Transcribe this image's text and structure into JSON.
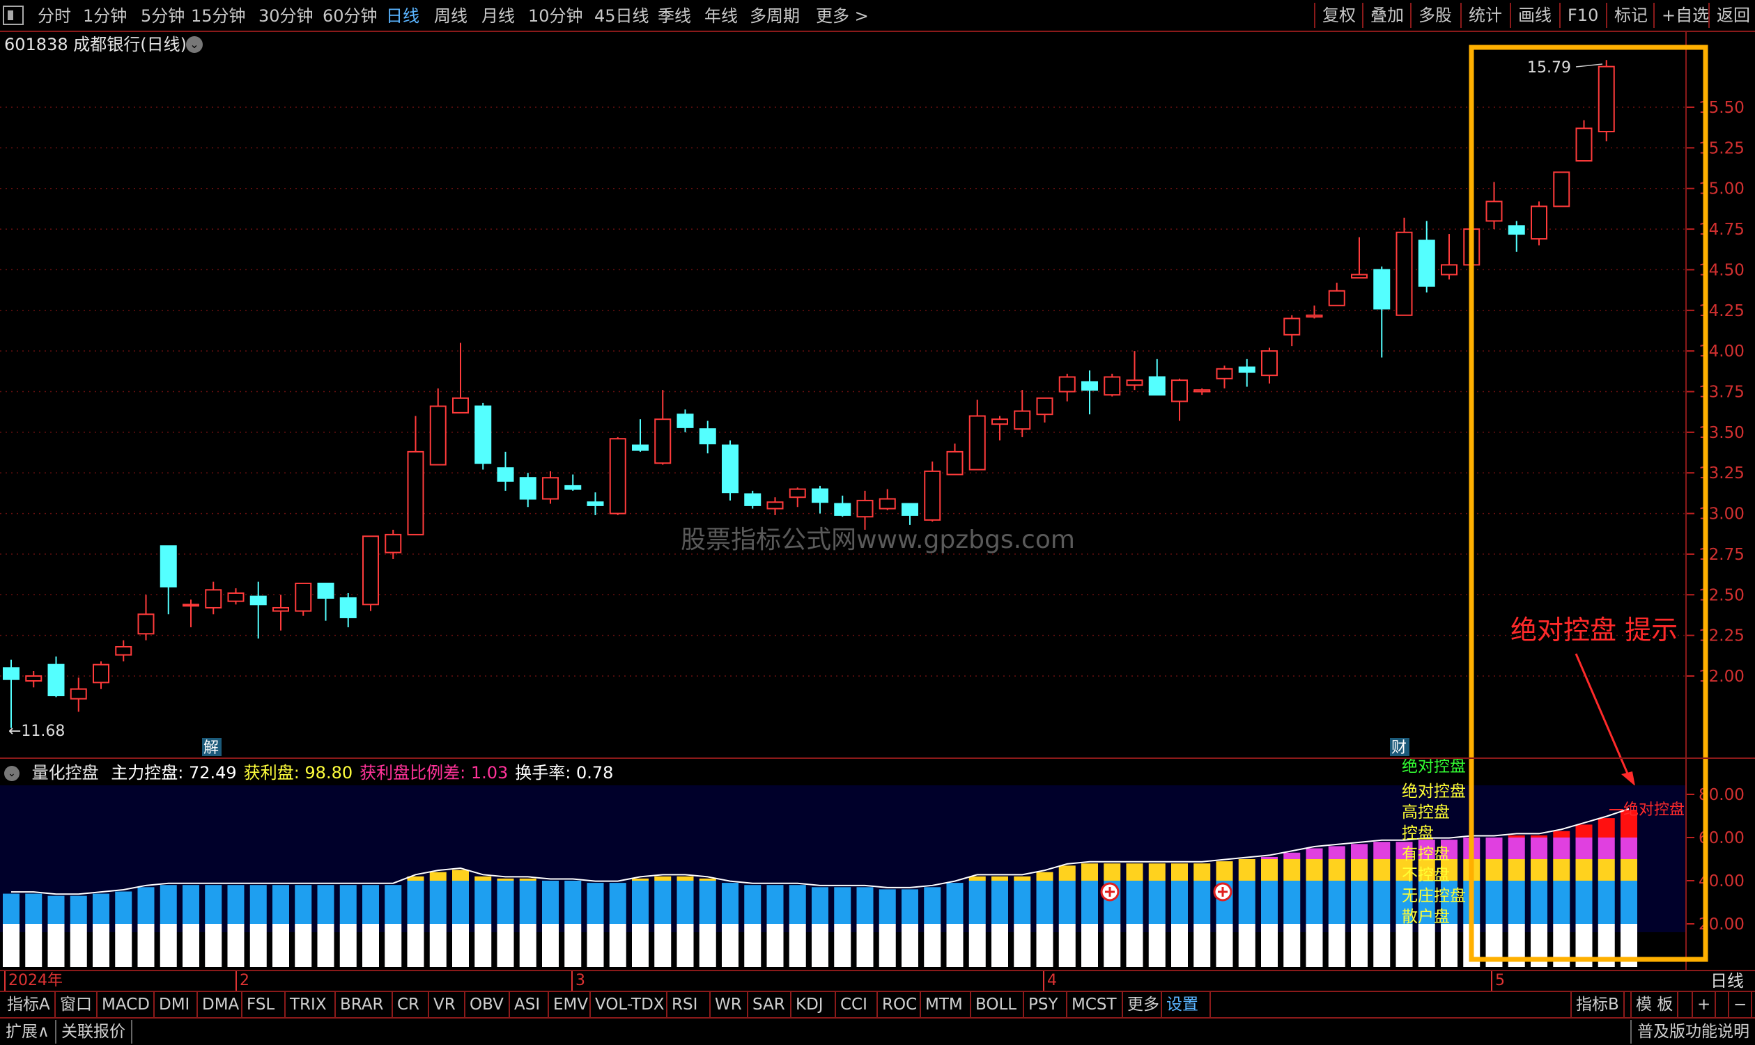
{
  "toolbar": {
    "periods": [
      "分时",
      "1分钟",
      "5分钟",
      "15分钟",
      "30分钟",
      "60分钟",
      "日线",
      "周线",
      "月线",
      "10分钟",
      "45日线",
      "季线",
      "年线",
      "多周期",
      "更多 >"
    ],
    "active_period": "日线",
    "right_buttons": [
      "复权",
      "叠加",
      "多股",
      "统计",
      "画线",
      "F10",
      "标记",
      "+自选",
      "返回"
    ]
  },
  "stock": {
    "title": "601838 成都银行(日线)"
  },
  "price_axis": [
    "15.50",
    "15.25",
    "15.00",
    "14.75",
    "14.50",
    "14.25",
    "14.00",
    "13.75",
    "13.50",
    "13.25",
    "13.00",
    "12.75",
    "12.50",
    "12.25",
    "12.00"
  ],
  "annotations": {
    "high_label": "15.79",
    "low_label": "←11.68",
    "watermark": "股票指标公式网www.gpzbgs.com",
    "hint": "绝对控盘 提示",
    "marker_jie": "解",
    "marker_cai": "财",
    "end_label": "绝对控盘"
  },
  "indicator": {
    "name": "量化控盘",
    "fields": [
      {
        "label": "主力控盘:",
        "value": "72.49",
        "color": "#ffffff"
      },
      {
        "label": "获利盘:",
        "value": "98.80",
        "color": "#ffff3c"
      },
      {
        "label": "获利盘比例差:",
        "value": "1.03",
        "color": "#ff3399"
      },
      {
        "label": "换手率:",
        "value": "0.78",
        "color": "#ffffff"
      }
    ],
    "axis": [
      "80.00",
      "60.00",
      "40.00",
      "20.00"
    ],
    "legend": [
      {
        "text": "绝对控盘",
        "color": "#33ff33"
      },
      {
        "text": "绝对控盘",
        "color": "#ffff33"
      },
      {
        "text": "高控盘",
        "color": "#ffff33"
      },
      {
        "text": "控盘",
        "color": "#ffff33"
      },
      {
        "text": "有控盘",
        "color": "#ffff33"
      },
      {
        "text": "不控盘",
        "color": "#ffff33"
      },
      {
        "text": "无庄控盘",
        "color": "#ffff33"
      },
      {
        "text": "散户盘",
        "color": "#ffff33"
      }
    ]
  },
  "date_axis": {
    "labels": [
      "2024年",
      "2",
      "3",
      "4",
      "5"
    ],
    "period": "日线"
  },
  "bottom_tabs": [
    "指标A",
    "窗口",
    "MACD",
    "DMI",
    "DMA",
    "FSL",
    "TRIX",
    "BRAR",
    "CR",
    "VR",
    "OBV",
    "ASI",
    "EMV",
    "VOL-TDX",
    "RSI",
    "WR",
    "SAR",
    "KDJ",
    "CCI",
    "ROC",
    "MTM",
    "BOLL",
    "PSY",
    "MCST",
    "更多",
    "设置"
  ],
  "bottom_right": [
    "指标B",
    "模 板",
    "+",
    "−"
  ],
  "status": {
    "left": [
      "扩展∧",
      "关联报价"
    ],
    "right": "普及版功能说明"
  },
  "chart_data": {
    "type": "candlestick",
    "price_range": [
      11.68,
      15.79
    ],
    "candles": [
      {
        "o": 12.05,
        "h": 12.1,
        "l": 11.68,
        "c": 11.98
      },
      {
        "o": 11.97,
        "h": 12.03,
        "l": 11.93,
        "c": 12.0
      },
      {
        "o": 12.07,
        "h": 12.12,
        "l": 11.87,
        "c": 11.88
      },
      {
        "o": 11.86,
        "h": 11.99,
        "l": 11.78,
        "c": 11.92
      },
      {
        "o": 11.96,
        "h": 12.09,
        "l": 11.92,
        "c": 12.07
      },
      {
        "o": 12.13,
        "h": 12.22,
        "l": 12.09,
        "c": 12.18
      },
      {
        "o": 12.26,
        "h": 12.5,
        "l": 12.22,
        "c": 12.38
      },
      {
        "o": 12.8,
        "h": 12.8,
        "l": 12.38,
        "c": 12.55
      },
      {
        "o": 12.44,
        "h": 12.47,
        "l": 12.3,
        "c": 12.44
      },
      {
        "o": 12.42,
        "h": 12.58,
        "l": 12.38,
        "c": 12.53
      },
      {
        "o": 12.46,
        "h": 12.54,
        "l": 12.44,
        "c": 12.51
      },
      {
        "o": 12.49,
        "h": 12.58,
        "l": 12.23,
        "c": 12.44
      },
      {
        "o": 12.4,
        "h": 12.5,
        "l": 12.28,
        "c": 12.42
      },
      {
        "o": 12.4,
        "h": 12.57,
        "l": 12.37,
        "c": 12.57
      },
      {
        "o": 12.57,
        "h": 12.57,
        "l": 12.34,
        "c": 12.48
      },
      {
        "o": 12.48,
        "h": 12.51,
        "l": 12.3,
        "c": 12.36
      },
      {
        "o": 12.44,
        "h": 12.86,
        "l": 12.4,
        "c": 12.86
      },
      {
        "o": 12.76,
        "h": 12.9,
        "l": 12.72,
        "c": 12.87
      },
      {
        "o": 12.87,
        "h": 13.6,
        "l": 12.87,
        "c": 13.38
      },
      {
        "o": 13.3,
        "h": 13.77,
        "l": 13.3,
        "c": 13.66
      },
      {
        "o": 13.62,
        "h": 14.05,
        "l": 13.62,
        "c": 13.71
      },
      {
        "o": 13.66,
        "h": 13.68,
        "l": 13.27,
        "c": 13.31
      },
      {
        "o": 13.28,
        "h": 13.38,
        "l": 13.14,
        "c": 13.2
      },
      {
        "o": 13.22,
        "h": 13.25,
        "l": 13.04,
        "c": 13.09
      },
      {
        "o": 13.09,
        "h": 13.26,
        "l": 13.06,
        "c": 13.22
      },
      {
        "o": 13.17,
        "h": 13.24,
        "l": 13.14,
        "c": 13.15
      },
      {
        "o": 13.07,
        "h": 13.13,
        "l": 12.99,
        "c": 13.05
      },
      {
        "o": 13.0,
        "h": 13.47,
        "l": 12.99,
        "c": 13.46
      },
      {
        "o": 13.42,
        "h": 13.58,
        "l": 13.38,
        "c": 13.39
      },
      {
        "o": 13.31,
        "h": 13.76,
        "l": 13.3,
        "c": 13.58
      },
      {
        "o": 13.61,
        "h": 13.64,
        "l": 13.5,
        "c": 13.53
      },
      {
        "o": 13.52,
        "h": 13.57,
        "l": 13.37,
        "c": 13.43
      },
      {
        "o": 13.42,
        "h": 13.45,
        "l": 13.08,
        "c": 13.13
      },
      {
        "o": 13.12,
        "h": 13.14,
        "l": 13.03,
        "c": 13.05
      },
      {
        "o": 13.03,
        "h": 13.1,
        "l": 12.99,
        "c": 13.07
      },
      {
        "o": 13.1,
        "h": 13.16,
        "l": 13.04,
        "c": 13.15
      },
      {
        "o": 13.15,
        "h": 13.17,
        "l": 13.0,
        "c": 13.07
      },
      {
        "o": 13.06,
        "h": 13.11,
        "l": 12.98,
        "c": 12.99
      },
      {
        "o": 12.98,
        "h": 13.14,
        "l": 12.9,
        "c": 13.08
      },
      {
        "o": 13.03,
        "h": 13.15,
        "l": 13.02,
        "c": 13.09
      },
      {
        "o": 13.06,
        "h": 13.06,
        "l": 12.93,
        "c": 12.99
      },
      {
        "o": 12.96,
        "h": 13.32,
        "l": 12.95,
        "c": 13.26
      },
      {
        "o": 13.24,
        "h": 13.43,
        "l": 13.24,
        "c": 13.38
      },
      {
        "o": 13.27,
        "h": 13.7,
        "l": 13.27,
        "c": 13.6
      },
      {
        "o": 13.55,
        "h": 13.6,
        "l": 13.45,
        "c": 13.58
      },
      {
        "o": 13.52,
        "h": 13.76,
        "l": 13.47,
        "c": 13.63
      },
      {
        "o": 13.61,
        "h": 13.71,
        "l": 13.56,
        "c": 13.71
      },
      {
        "o": 13.75,
        "h": 13.86,
        "l": 13.69,
        "c": 13.84
      },
      {
        "o": 13.81,
        "h": 13.88,
        "l": 13.61,
        "c": 13.76
      },
      {
        "o": 13.73,
        "h": 13.86,
        "l": 13.72,
        "c": 13.84
      },
      {
        "o": 13.79,
        "h": 14.0,
        "l": 13.76,
        "c": 13.82
      },
      {
        "o": 13.84,
        "h": 13.95,
        "l": 13.75,
        "c": 13.73
      },
      {
        "o": 13.69,
        "h": 13.83,
        "l": 13.57,
        "c": 13.82
      },
      {
        "o": 13.75,
        "h": 13.77,
        "l": 13.73,
        "c": 13.76
      },
      {
        "o": 13.83,
        "h": 13.91,
        "l": 13.77,
        "c": 13.89
      },
      {
        "o": 13.9,
        "h": 13.95,
        "l": 13.78,
        "c": 13.87
      },
      {
        "o": 13.85,
        "h": 14.02,
        "l": 13.8,
        "c": 14.0
      },
      {
        "o": 14.1,
        "h": 14.22,
        "l": 14.03,
        "c": 14.2
      },
      {
        "o": 14.21,
        "h": 14.28,
        "l": 14.2,
        "c": 14.22
      },
      {
        "o": 14.28,
        "h": 14.42,
        "l": 14.28,
        "c": 14.37
      },
      {
        "o": 14.45,
        "h": 14.7,
        "l": 14.45,
        "c": 14.47
      },
      {
        "o": 14.5,
        "h": 14.52,
        "l": 13.96,
        "c": 14.26
      },
      {
        "o": 14.22,
        "h": 14.82,
        "l": 14.22,
        "c": 14.73
      },
      {
        "o": 14.68,
        "h": 14.8,
        "l": 14.36,
        "c": 14.4
      },
      {
        "o": 14.47,
        "h": 14.72,
        "l": 14.44,
        "c": 14.53
      },
      {
        "o": 14.53,
        "h": 14.75,
        "l": 14.53,
        "c": 14.75
      },
      {
        "o": 14.8,
        "h": 15.04,
        "l": 14.75,
        "c": 14.92
      },
      {
        "o": 14.77,
        "h": 14.8,
        "l": 14.61,
        "c": 14.72
      },
      {
        "o": 14.69,
        "h": 14.92,
        "l": 14.65,
        "c": 14.89
      },
      {
        "o": 14.89,
        "h": 15.1,
        "l": 14.89,
        "c": 15.1
      },
      {
        "o": 15.17,
        "h": 15.42,
        "l": 15.17,
        "c": 15.37
      },
      {
        "o": 15.35,
        "h": 15.79,
        "l": 15.29,
        "c": 15.75
      }
    ],
    "indicator_bars": {
      "type": "stacked-bar",
      "series_colors": [
        "#ffffff",
        "#1e9ff0",
        "#ffd21e",
        "#e040e0",
        "#ff1010"
      ],
      "thresholds": [
        20,
        40,
        50,
        60,
        70
      ],
      "axis_range": [
        0,
        90
      ],
      "values": [
        34,
        34,
        33,
        33,
        34,
        35,
        37,
        38,
        38,
        38,
        38,
        38,
        38,
        38,
        38,
        38,
        38,
        38,
        42,
        44,
        45,
        42,
        41,
        41,
        40,
        40,
        39,
        39,
        41,
        42,
        42,
        41,
        39,
        38,
        38,
        38,
        37,
        37,
        37,
        36,
        36,
        37,
        39,
        42,
        42,
        42,
        44,
        47,
        48,
        48,
        48,
        48,
        48,
        48,
        49,
        50,
        51,
        53,
        55,
        56,
        57,
        58,
        58,
        59,
        59,
        60,
        60,
        61,
        61,
        63,
        66,
        69,
        72.49
      ]
    }
  }
}
